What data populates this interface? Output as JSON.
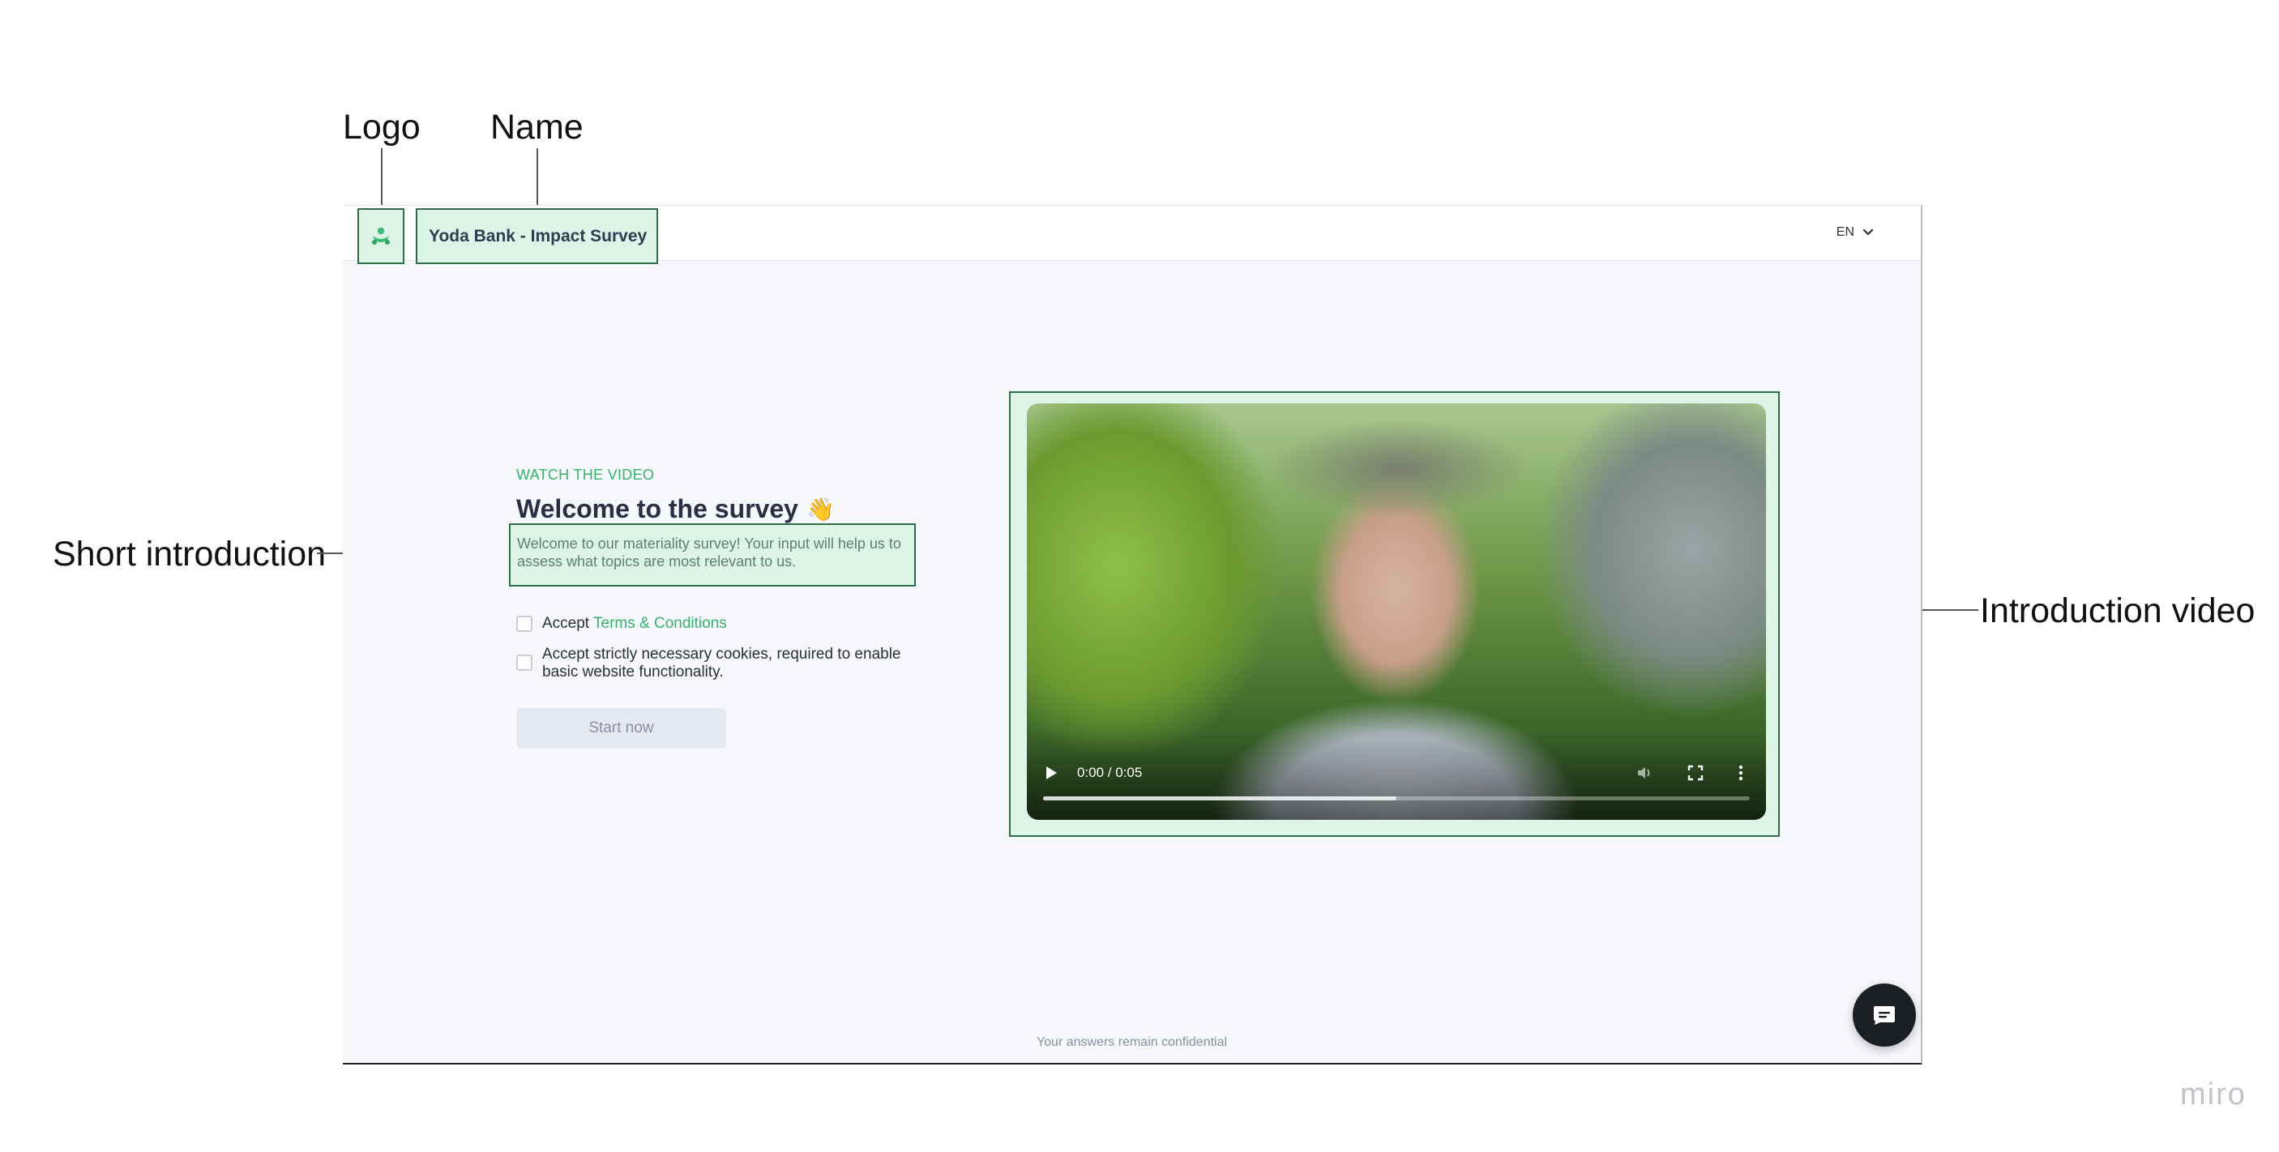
{
  "annotations": {
    "logo": "Logo",
    "name": "Name",
    "short_intro": "Short introduction",
    "intro_video": "Introduction video"
  },
  "header": {
    "logo_icon": "green-people-logo-icon",
    "app_name": "Yoda Bank - Impact Survey",
    "language": "EN"
  },
  "intro": {
    "eyebrow": "WATCH THE VIDEO",
    "title": "Welcome to the survey",
    "title_emoji": "👋",
    "description": "Welcome to our materiality survey! Your input will help us to assess what topics are most relevant to us."
  },
  "consent": {
    "terms_prefix": "Accept",
    "terms_link": "Terms & Conditions",
    "cookies_label": "Accept strictly necessary cookies, required to enable basic website functionality."
  },
  "actions": {
    "start_label": "Start now"
  },
  "video": {
    "time": "0:00 / 0:05",
    "buffered_fraction": 0.5
  },
  "footer": {
    "note": "Your answers remain confidential"
  },
  "watermark": "miro",
  "colors": {
    "accent_green": "#34b36b",
    "annotation_fill": "#dcf5e7",
    "annotation_border": "#2d6e4b",
    "title": "#2a2f45"
  }
}
